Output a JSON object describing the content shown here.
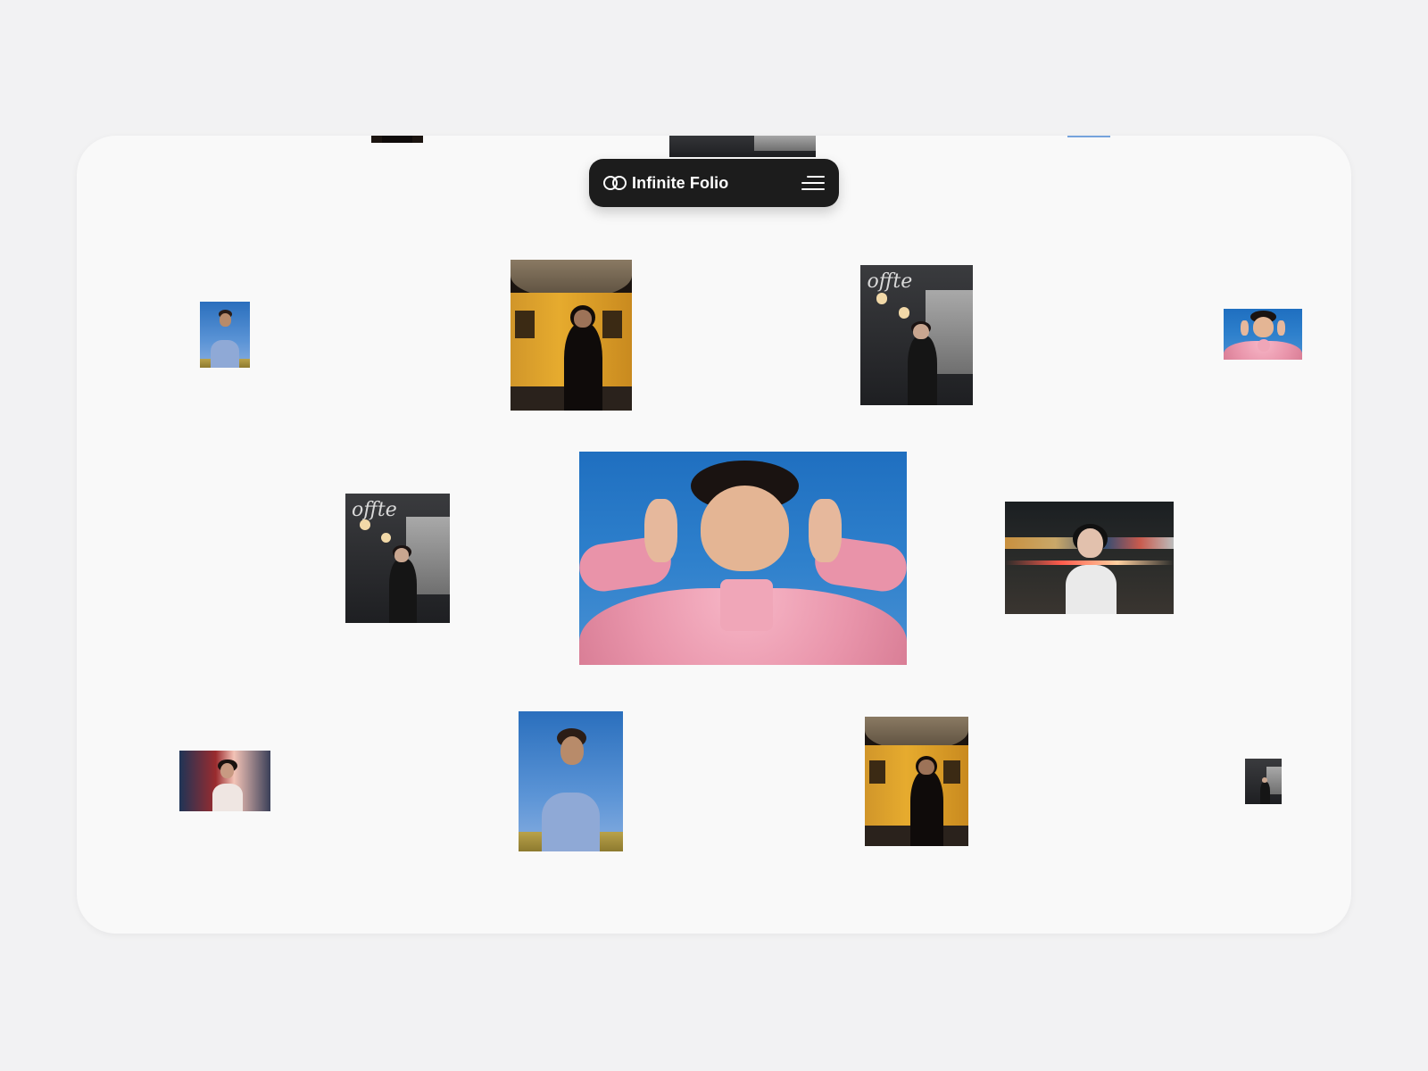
{
  "header": {
    "brand_name": "Infinite Folio",
    "logo_icon": "infinity-icon",
    "menu_icon": "hamburger-menu-icon"
  },
  "gallery": {
    "photos": [
      {
        "subject": "man-sky"
      },
      {
        "subject": "woman-train"
      },
      {
        "subject": "woman-cafe"
      },
      {
        "subject": "woman-pink-sky"
      },
      {
        "subject": "woman-night-street"
      },
      {
        "subject": "woman-motion-blur"
      }
    ],
    "cafe_sign": "offte"
  }
}
